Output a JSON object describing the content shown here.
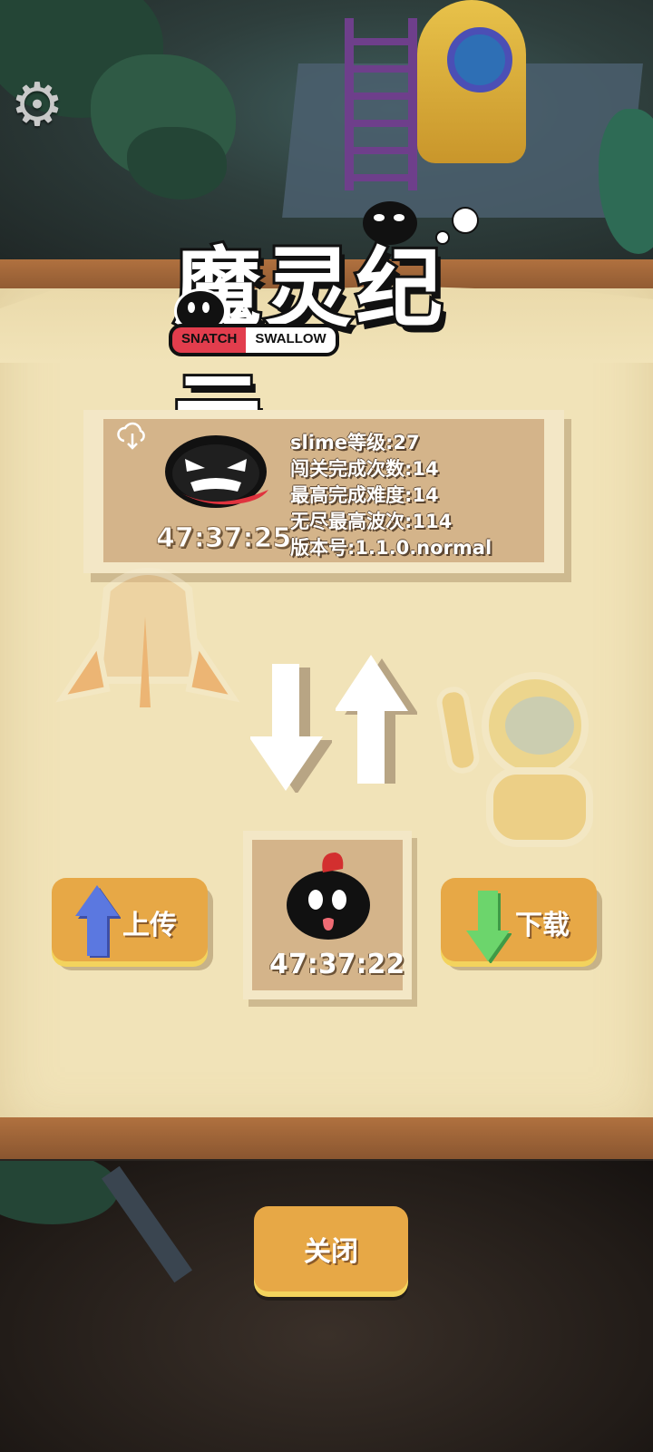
{
  "logo": {
    "title": "魔灵纪元",
    "tag_left": "SNATCH",
    "tag_right": "SWALLOW"
  },
  "save_card": {
    "time": "47:37:25",
    "stats": [
      "slime等级:27",
      "闯关完成次数:14",
      "最高完成难度:14",
      "无尽最高波次:114",
      "版本号:1.1.0.normal"
    ]
  },
  "local_slot": {
    "time": "47:37:22"
  },
  "buttons": {
    "upload": "上传",
    "download": "下载",
    "close": "关闭"
  },
  "icons": {
    "settings": "gear-icon",
    "cloud": "cloud-download-icon",
    "upload_arrow": "arrow-up-icon",
    "download_arrow": "arrow-down-icon"
  },
  "colors": {
    "button": "#e7a846",
    "upload_arrow": "#5b78e0",
    "download_arrow": "#6cd56c",
    "paper": "#f1e3b8",
    "card": "#d4b48a"
  }
}
